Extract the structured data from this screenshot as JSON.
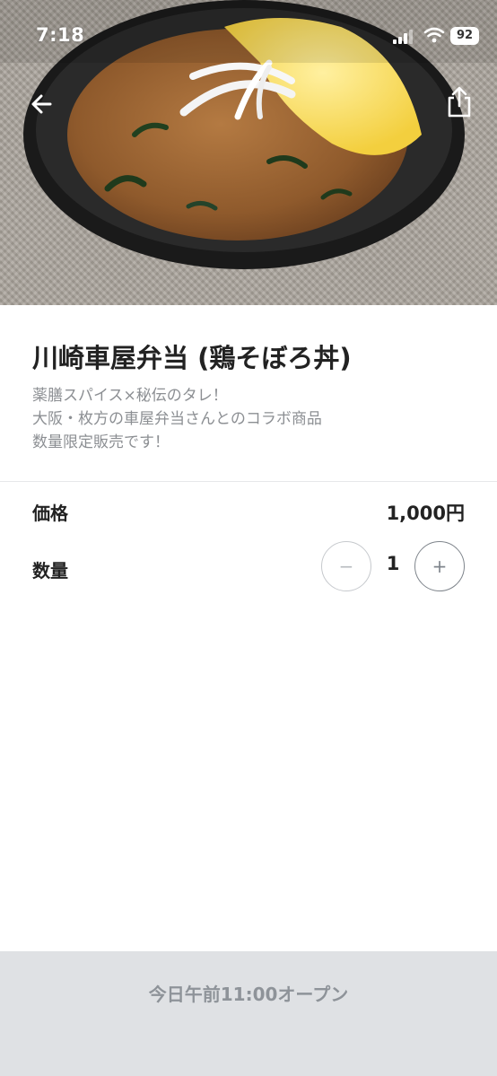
{
  "status_bar": {
    "time": "7:18",
    "battery": "92",
    "icons": [
      "signal-icon",
      "wifi-icon",
      "battery-icon"
    ]
  },
  "header": {
    "back_icon": "back-arrow-icon",
    "share_icon": "share-icon"
  },
  "product": {
    "name": "川崎車屋弁当 (鶏そぼろ丼)",
    "description_lines": [
      "薬膳スパイス×秘伝のタレ！",
      "大阪・枚方の車屋弁当さんとのコラボ商品",
      "数量限定販売です！"
    ]
  },
  "price_row": {
    "label": "価格",
    "value": "1,000円"
  },
  "quantity_row": {
    "label": "数量",
    "minus_label": "−",
    "plus_label": "+",
    "value": "1"
  },
  "footer": {
    "label": "今日午前11:00オープン"
  },
  "colors": {
    "text_primary": "#222222",
    "text_secondary": "#8c8f93",
    "footer_bg": "#dfe1e4",
    "footer_text": "#8e9399"
  }
}
